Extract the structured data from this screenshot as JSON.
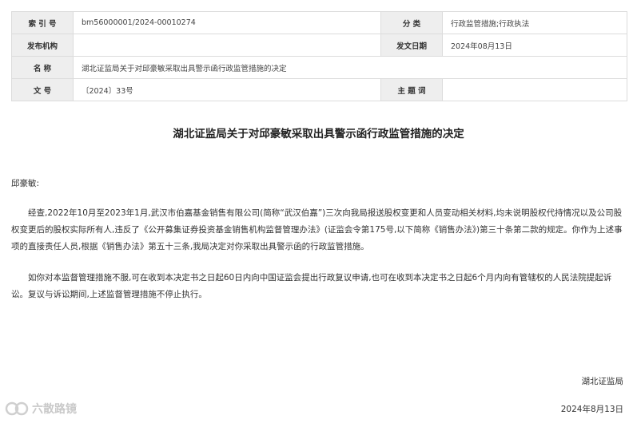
{
  "meta": {
    "index_label": "索 引 号",
    "index_value": "bm56000001/2024-00010274",
    "category_label": "分 类",
    "category_value": "行政监管措施;行政执法",
    "issuer_label": "发布机构",
    "issuer_value": "",
    "date_label": "发文日期",
    "date_value": "2024年08月13日",
    "name_label": "名 称",
    "name_value": "湖北证监局关于对邱豪敏采取出具警示函行政监管措施的决定",
    "doc_no_label": "文 号",
    "doc_no_value": "〔2024〕33号",
    "subject_label": "主 题 词",
    "subject_value": ""
  },
  "document": {
    "title": "湖北证监局关于对邱豪敏采取出具警示函行政监管措施的决定",
    "salutation": "邱豪敏:",
    "paragraph1": "经查,2022年10月至2023年1月,武汉市伯嘉基金销售有限公司(简称“武汉伯嘉”)三次向我局报送股权变更和人员变动相关材料,均未说明股权代持情况以及公司股权变更后的股权实际所有人,违反了《公开募集证券投资基金销售机构监督管理办法》(证监会令第175号,以下简称《销售办法》)第三十条第二款的规定。你作为上述事项的直接责任人员,根据《销售办法》第五十三条,我局决定对你采取出具警示函的行政监管措施。",
    "paragraph2": "如你对本监督管理措施不服,可在收到本决定书之日起60日内向中国证监会提出行政复议申请,也可在收到本决定书之日起6个月内向有管辖权的人民法院提起诉讼。复议与诉讼期间,上述监督管理措施不停止执行。",
    "signature": "湖北证监局",
    "date": "2024年8月13日"
  },
  "watermark": {
    "text": "六散路镜",
    "logo_icon": "watermark-logo-icon"
  }
}
